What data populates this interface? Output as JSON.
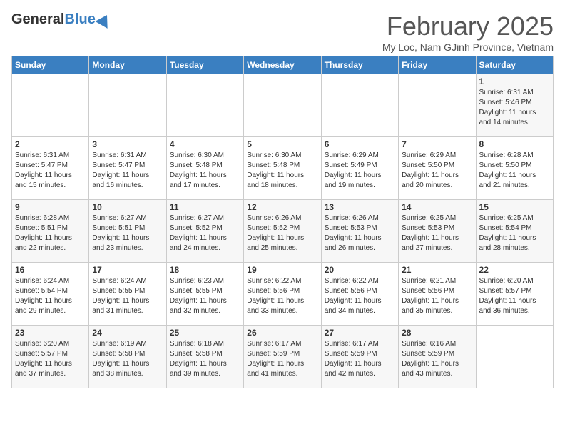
{
  "header": {
    "logo_general": "General",
    "logo_blue": "Blue",
    "month_title": "February 2025",
    "location": "My Loc, Nam GJinh Province, Vietnam"
  },
  "days_of_week": [
    "Sunday",
    "Monday",
    "Tuesday",
    "Wednesday",
    "Thursday",
    "Friday",
    "Saturday"
  ],
  "weeks": [
    [
      {
        "day": "",
        "info": ""
      },
      {
        "day": "",
        "info": ""
      },
      {
        "day": "",
        "info": ""
      },
      {
        "day": "",
        "info": ""
      },
      {
        "day": "",
        "info": ""
      },
      {
        "day": "",
        "info": ""
      },
      {
        "day": "1",
        "info": "Sunrise: 6:31 AM\nSunset: 5:46 PM\nDaylight: 11 hours\nand 14 minutes."
      }
    ],
    [
      {
        "day": "2",
        "info": "Sunrise: 6:31 AM\nSunset: 5:47 PM\nDaylight: 11 hours\nand 15 minutes."
      },
      {
        "day": "3",
        "info": "Sunrise: 6:31 AM\nSunset: 5:47 PM\nDaylight: 11 hours\nand 16 minutes."
      },
      {
        "day": "4",
        "info": "Sunrise: 6:30 AM\nSunset: 5:48 PM\nDaylight: 11 hours\nand 17 minutes."
      },
      {
        "day": "5",
        "info": "Sunrise: 6:30 AM\nSunset: 5:48 PM\nDaylight: 11 hours\nand 18 minutes."
      },
      {
        "day": "6",
        "info": "Sunrise: 6:29 AM\nSunset: 5:49 PM\nDaylight: 11 hours\nand 19 minutes."
      },
      {
        "day": "7",
        "info": "Sunrise: 6:29 AM\nSunset: 5:50 PM\nDaylight: 11 hours\nand 20 minutes."
      },
      {
        "day": "8",
        "info": "Sunrise: 6:28 AM\nSunset: 5:50 PM\nDaylight: 11 hours\nand 21 minutes."
      }
    ],
    [
      {
        "day": "9",
        "info": "Sunrise: 6:28 AM\nSunset: 5:51 PM\nDaylight: 11 hours\nand 22 minutes."
      },
      {
        "day": "10",
        "info": "Sunrise: 6:27 AM\nSunset: 5:51 PM\nDaylight: 11 hours\nand 23 minutes."
      },
      {
        "day": "11",
        "info": "Sunrise: 6:27 AM\nSunset: 5:52 PM\nDaylight: 11 hours\nand 24 minutes."
      },
      {
        "day": "12",
        "info": "Sunrise: 6:26 AM\nSunset: 5:52 PM\nDaylight: 11 hours\nand 25 minutes."
      },
      {
        "day": "13",
        "info": "Sunrise: 6:26 AM\nSunset: 5:53 PM\nDaylight: 11 hours\nand 26 minutes."
      },
      {
        "day": "14",
        "info": "Sunrise: 6:25 AM\nSunset: 5:53 PM\nDaylight: 11 hours\nand 27 minutes."
      },
      {
        "day": "15",
        "info": "Sunrise: 6:25 AM\nSunset: 5:54 PM\nDaylight: 11 hours\nand 28 minutes."
      }
    ],
    [
      {
        "day": "16",
        "info": "Sunrise: 6:24 AM\nSunset: 5:54 PM\nDaylight: 11 hours\nand 29 minutes."
      },
      {
        "day": "17",
        "info": "Sunrise: 6:24 AM\nSunset: 5:55 PM\nDaylight: 11 hours\nand 31 minutes."
      },
      {
        "day": "18",
        "info": "Sunrise: 6:23 AM\nSunset: 5:55 PM\nDaylight: 11 hours\nand 32 minutes."
      },
      {
        "day": "19",
        "info": "Sunrise: 6:22 AM\nSunset: 5:56 PM\nDaylight: 11 hours\nand 33 minutes."
      },
      {
        "day": "20",
        "info": "Sunrise: 6:22 AM\nSunset: 5:56 PM\nDaylight: 11 hours\nand 34 minutes."
      },
      {
        "day": "21",
        "info": "Sunrise: 6:21 AM\nSunset: 5:56 PM\nDaylight: 11 hours\nand 35 minutes."
      },
      {
        "day": "22",
        "info": "Sunrise: 6:20 AM\nSunset: 5:57 PM\nDaylight: 11 hours\nand 36 minutes."
      }
    ],
    [
      {
        "day": "23",
        "info": "Sunrise: 6:20 AM\nSunset: 5:57 PM\nDaylight: 11 hours\nand 37 minutes."
      },
      {
        "day": "24",
        "info": "Sunrise: 6:19 AM\nSunset: 5:58 PM\nDaylight: 11 hours\nand 38 minutes."
      },
      {
        "day": "25",
        "info": "Sunrise: 6:18 AM\nSunset: 5:58 PM\nDaylight: 11 hours\nand 39 minutes."
      },
      {
        "day": "26",
        "info": "Sunrise: 6:17 AM\nSunset: 5:59 PM\nDaylight: 11 hours\nand 41 minutes."
      },
      {
        "day": "27",
        "info": "Sunrise: 6:17 AM\nSunset: 5:59 PM\nDaylight: 11 hours\nand 42 minutes."
      },
      {
        "day": "28",
        "info": "Sunrise: 6:16 AM\nSunset: 5:59 PM\nDaylight: 11 hours\nand 43 minutes."
      },
      {
        "day": "",
        "info": ""
      }
    ]
  ]
}
